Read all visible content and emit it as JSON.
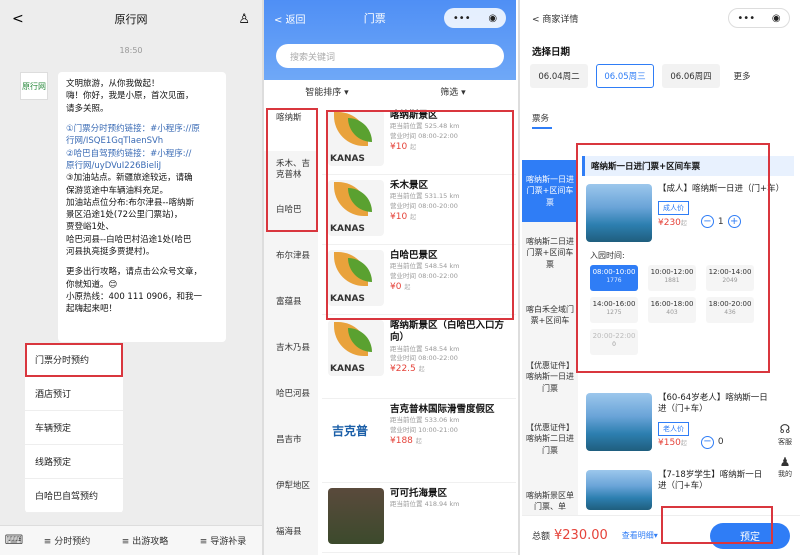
{
  "wechat": {
    "back": "<",
    "title": "原行网",
    "profile": "♙",
    "time": "18:50",
    "avatar": "原行网",
    "message": [
      "文明旅游，从你我做起！",
      "嗨！你好，我是小原，首次见面，",
      "请多关照。",
      "",
      "①门票分时预约链接：#小程序://原",
      "行网/ISQE1GqTlaenSVh",
      "②哈巴自驾预约链接：#小程序://",
      "原行网/uyDVuI226BieliJ",
      "③加油站点。新疆旅途较远，请确",
      "保游览途中车辆油料充足。",
      "加油站点位分布:布尔津县--喀纳斯",
      "景区沿途1处(72公里门票站)，",
      "贾登峪1处、",
      "哈巴河县--白哈巴村沿途1处(哈巴",
      "河县执亮挺多贾提村)。",
      "",
      "更多出行攻略，请点击公众号文章，",
      "你就知道。😊",
      "小原热线：400 111 0906，和我一",
      "起嗨起来吧！"
    ],
    "menu": [
      "门票分时预约",
      "酒店预订",
      "车辆预定",
      "线路预定",
      "白哈巴自驾预约"
    ],
    "bottom": [
      "分时预约",
      "出游攻略",
      "导游补录"
    ]
  },
  "tickets": {
    "back": "< 返回",
    "title": "门票",
    "search_placeholder": "搜索关键词",
    "sort": "智能排序 ▾",
    "filter": "筛选 ▾",
    "categories": [
      "喀纳斯",
      "禾木、吉克普林",
      "白哈巴",
      "布尔津县",
      "富蕴县",
      "吉木乃县",
      "哈巴河县",
      "昌吉市",
      "伊犁地区",
      "福海县"
    ],
    "items": [
      {
        "name": "喀纳斯景区",
        "dist": "距当前位置 525.48 km",
        "hours": "营业时间 08:00-22:00",
        "price": "¥10",
        "suffix": "起",
        "logo": "KANAS"
      },
      {
        "name": "禾木景区",
        "dist": "距当前位置 531.15 km",
        "hours": "营业时间 08:00-20:00",
        "price": "¥10",
        "suffix": "起",
        "logo": "KANAS"
      },
      {
        "name": "白哈巴景区",
        "dist": "距当前位置 548.54 km",
        "hours": "营业时间 08:00-22:00",
        "price": "¥0",
        "suffix": "起",
        "logo": "KANAS"
      },
      {
        "name": "喀纳斯景区（白哈巴入口方向）",
        "dist": "距当前位置 548.54 km",
        "hours": "营业时间 08:00-22:00",
        "price": "¥22.5",
        "suffix": "起",
        "logo": "KANAS"
      },
      {
        "name": "吉克普林国际滑雪度假区",
        "dist": "距当前位置 533.06 km",
        "hours": "营业时间 10:00-21:00",
        "price": "¥188",
        "suffix": "起",
        "logo": "吉克普"
      },
      {
        "name": "可可托海景区",
        "dist": "距当前位置 418.94 km",
        "hours": "",
        "price": "",
        "suffix": "",
        "logo": ""
      }
    ]
  },
  "detail": {
    "back": "< 商家详情",
    "select_date": "选择日期",
    "dates": [
      "06.04周二",
      "06.05周三",
      "06.06周四",
      "更多"
    ],
    "tab": "票务",
    "cats": [
      "喀纳斯一日进门票+区间车票",
      "喀纳斯二日进门票+区间车票",
      "喀白禾全域门票+区间车",
      "【优惠证件】喀纳斯一日进门票",
      "【优惠证件】喀纳斯二日进门票",
      "喀纳斯景区单门票、单"
    ],
    "pkg_head": "喀纳斯一日进门票+区间车票",
    "products": [
      {
        "name": "【成人】喀纳斯一日进（门+车）",
        "tag": "成人价",
        "price": "¥230",
        "suffix": "起",
        "qty": "1"
      },
      {
        "name": "【60-64岁老人】喀纳斯一日进（门+车）",
        "tag": "老人价",
        "price": "¥150",
        "suffix": "起",
        "qty": "0"
      },
      {
        "name": "【7-18岁学生】喀纳斯一日进（门+车）",
        "tag": "",
        "price": "",
        "suffix": "",
        "qty": ""
      }
    ],
    "slot_label": "入园时间:",
    "slots": [
      {
        "time": "08:00-10:00",
        "count": "1776"
      },
      {
        "time": "10:00-12:00",
        "count": "1881"
      },
      {
        "time": "12:00-14:00",
        "count": "2049"
      },
      {
        "time": "14:00-16:00",
        "count": "1275"
      },
      {
        "time": "16:00-18:00",
        "count": "403"
      },
      {
        "time": "18:00-20:00",
        "count": "436"
      },
      {
        "time": "20:00-22:00",
        "count": "0"
      }
    ],
    "side": [
      "客服",
      "我的"
    ],
    "total_label": "总额",
    "total": "¥230.00",
    "details": "查看明细▾",
    "book": "预定"
  }
}
